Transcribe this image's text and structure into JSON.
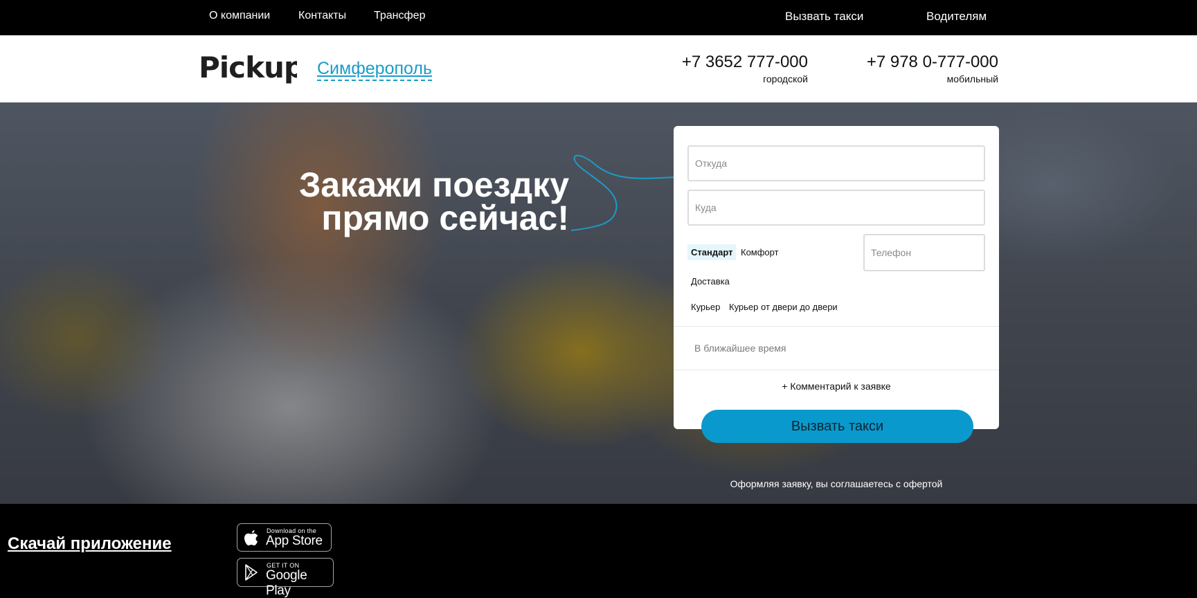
{
  "topnav": {
    "left": [
      "О компании",
      "Контакты",
      "Трансфер"
    ],
    "right": [
      "Вызвать такси",
      "Водителям"
    ]
  },
  "header": {
    "logo": "Pickup",
    "city": "Симферополь",
    "phones": [
      {
        "number": "+7 3652 777-000",
        "label": "городской"
      },
      {
        "number": "+7 978 0-777-000",
        "label": "мобильный"
      }
    ]
  },
  "hero": {
    "title_line1": "Закажи поездку",
    "title_line2": "прямо сейчас!"
  },
  "form": {
    "from_placeholder": "Откуда",
    "to_placeholder": "Куда",
    "phone_placeholder": "Телефон",
    "tariffs": [
      "Стандарт",
      "Комфорт",
      "Доставка",
      "Курьер",
      "Курьер от двери до двери"
    ],
    "active_tariff": "Стандарт",
    "time": "В ближайшее время",
    "comment": "+ Комментарий к заявке",
    "submit": "Вызвать такси",
    "offer": "Оформляя заявку, вы соглашаетесь с офертой"
  },
  "footer": {
    "download_title": "Скачай приложение",
    "appstore_small": "Download on the",
    "appstore_big": "App Store",
    "googleplay_small": "GET IT ON",
    "googleplay_big": "Google Play"
  },
  "colors": {
    "accent": "#0a99cc",
    "city_link": "#1a9cc9",
    "active_tariff_bg": "#e4f6fb"
  }
}
